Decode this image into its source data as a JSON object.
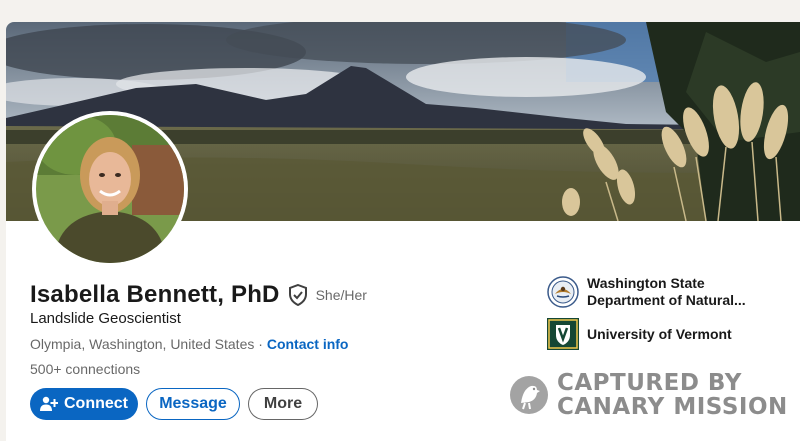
{
  "profile": {
    "name": "Isabella Bennett, PhD",
    "pronouns": "She/Her",
    "headline": "Landslide Geoscientist",
    "location": "Olympia, Washington, United States",
    "location_separator": " · ",
    "contact_info": "Contact info",
    "connections": "500+ connections"
  },
  "actions": {
    "connect": "Connect",
    "message": "Message",
    "more": "More"
  },
  "organizations": [
    {
      "name_line1": "Washington State",
      "name_line2": "Department of Natural...",
      "logo": "seal-icon"
    },
    {
      "name_line1": "University of Vermont",
      "logo": "uvm-shield-icon"
    }
  ],
  "watermark": {
    "line1": "CAPTURED BY",
    "line2": "CANARY MISSION"
  },
  "icons": {
    "verified": "verified-shield-icon",
    "connect": "add-person-icon",
    "watermark": "canary-bird-icon"
  },
  "colors": {
    "accent": "#0a66c2",
    "page_background": "#f4f2ee",
    "card_background": "#ffffff"
  }
}
